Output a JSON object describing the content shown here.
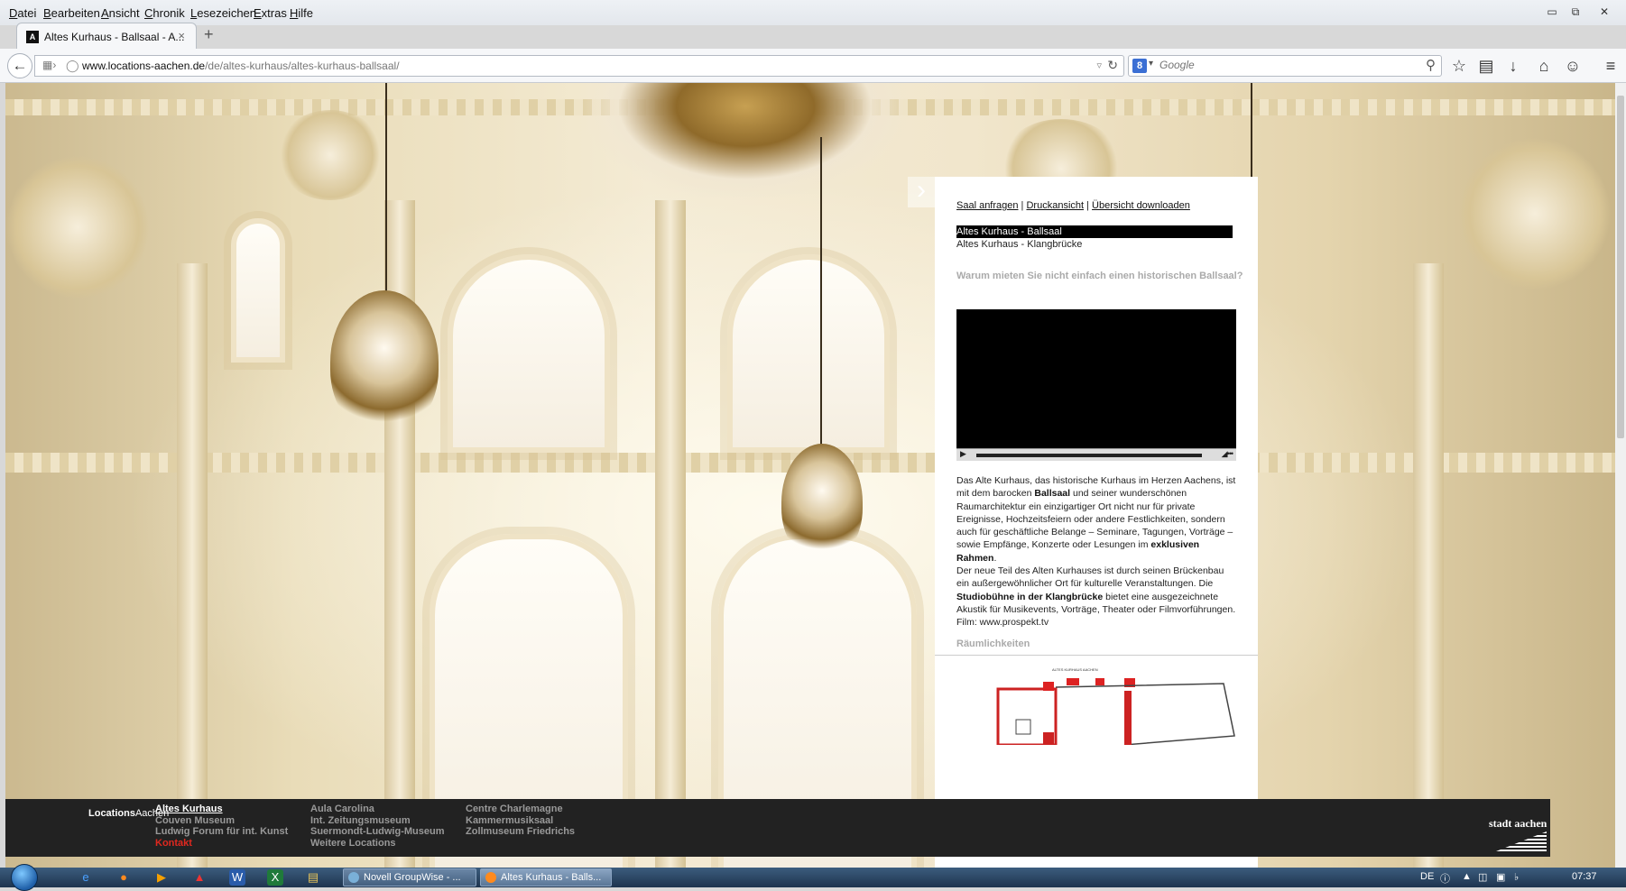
{
  "menubar": {
    "items": [
      "Datei",
      "Bearbeiten",
      "Ansicht",
      "Chronik",
      "Lesezeichen",
      "Extras",
      "Hilfe"
    ]
  },
  "window_controls": [
    "▭",
    "⧉",
    "✕"
  ],
  "tab": {
    "title": "Altes Kurhaus - Ballsaal - A...",
    "close": "×",
    "new_tab": "+"
  },
  "navbar": {
    "url_host": "www.locations-aachen.de",
    "url_path": "/de/altes-kurhaus/altes-kurhaus-ballsaal/",
    "search_placeholder": "Google",
    "search_engine_icon": "8"
  },
  "icons": {
    "back": "back-arrow-icon",
    "bookmark": "star-icon",
    "library": "clipboard-icon",
    "download": "download-icon",
    "home": "home-icon",
    "chat": "chat-icon",
    "menu": "hamburger-icon"
  },
  "panel": {
    "links": [
      "Saal anfragen",
      "Druckansicht",
      "Übersicht downloaden"
    ],
    "locations": [
      "Altes Kurhaus - Ballsaal",
      "Altes Kurhaus - Klangbrücke"
    ],
    "heading": "Warum mieten Sie nicht einfach einen historischen Ballsaal?",
    "description": {
      "p1_a": "Das Alte Kurhaus, das historische Kurhaus im Herzen Aachens, ist mit dem barocken ",
      "p1_bold1": "Ballsaal",
      "p1_b": " und seiner wunderschönen Raumarchitektur ein einzigartiger Ort nicht nur für private Ereignisse, Hochzeitsfeiern oder andere Festlichkeiten, sondern auch für geschäftliche Belange – Seminare, Tagungen, Vorträge – sowie Empfänge, Konzerte oder Lesungen im ",
      "p1_bold2": "exklusiven Rahmen",
      "p1_c": ".",
      "p2_a": "Der neue Teil des Alten Kurhauses ist durch seinen Brückenbau ein außergewöhnlicher Ort für kulturelle Veranstaltungen. Die ",
      "p2_bold": "Studiobühne in der Klangbrücke",
      "p2_b": " bietet eine ausgezeichnete Akustik für Musikevents, Vorträge, Theater oder Filmvorführungen.",
      "film": "Film: www.prospekt.tv"
    },
    "rooms_heading": "Räumlichkeiten",
    "floorplan_title": "ALTES KURHAUS AACHEN"
  },
  "footer": {
    "brand_bold": "Locations",
    "brand_rest": "Aachen",
    "col1": [
      "Altes Kurhaus",
      "Couven Museum",
      "Ludwig Forum für int. Kunst",
      "Kontakt"
    ],
    "col2": [
      "Aula Carolina",
      "Int. Zeitungsmuseum",
      "Suermondt-Ludwig-Museum",
      "Weitere Locations"
    ],
    "col3": [
      "Centre Charlemagne",
      "Kammermusiksaal",
      "Zollmuseum Friedrichs"
    ],
    "logo": "stadt aachen"
  },
  "taskbar": {
    "tasks": [
      "Novell GroupWise - ...",
      "Altes Kurhaus - Balls..."
    ],
    "language": "DE",
    "clock": "07:37"
  },
  "colors": {
    "accent_red": "#e0281f",
    "footer_bg": "#222222",
    "active_location_bg": "#000000"
  }
}
